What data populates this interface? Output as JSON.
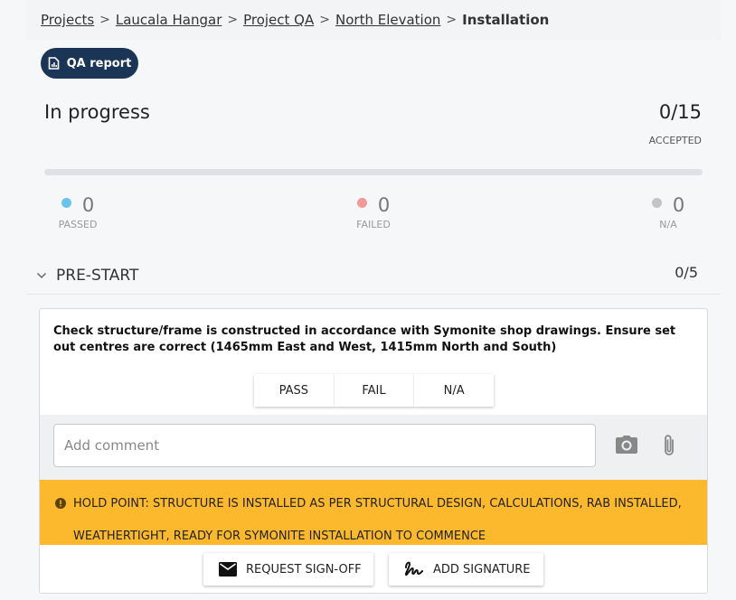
{
  "breadcrumb": {
    "items": [
      "Projects",
      "Laucala Hangar",
      "Project QA",
      "North Elevation"
    ],
    "current": "Installation"
  },
  "qa_report_button": "QA report",
  "summary": {
    "status": "In progress",
    "accepted_count": "0/15",
    "accepted_label": "ACCEPTED",
    "progress_fraction": 0
  },
  "stats": {
    "passed": {
      "value": "0",
      "label": "PASSED",
      "color": "#6cc3ea"
    },
    "failed": {
      "value": "0",
      "label": "FAILED",
      "color": "#f29a9a"
    },
    "na": {
      "value": "0",
      "label": "N/A",
      "color": "#c4c4c4"
    }
  },
  "section": {
    "title": "PRE-START",
    "count": "0/5"
  },
  "check": {
    "question": "Check structure/frame is constructed in accordance with Symonite shop drawings. Ensure set out centres are correct (1465mm East and West, 1415mm North and South)",
    "choices": [
      "PASS",
      "FAIL",
      "N/A"
    ],
    "comment_placeholder": "Add comment",
    "hold_point_line1": "HOLD POINT: STRUCTURE IS INSTALLED AS PER STRUCTURAL DESIGN, CALCULATIONS, RAB INSTALLED,",
    "hold_point_line2": "WEATHERTIGHT, READY FOR SYMONITE INSTALLATION TO COMMENCE",
    "hold_color": "#fdb92e",
    "request_signoff_label": "REQUEST SIGN-OFF",
    "add_signature_label": "ADD SIGNATURE"
  },
  "icons": {
    "qa_report": "report-icon",
    "section": "chevron-down-icon",
    "camera": "camera-icon",
    "attachment": "paperclip-icon",
    "hold": "alert-icon",
    "request": "envelope-icon",
    "signature": "signature-icon"
  },
  "colors": {
    "brand": "#1b3557"
  }
}
